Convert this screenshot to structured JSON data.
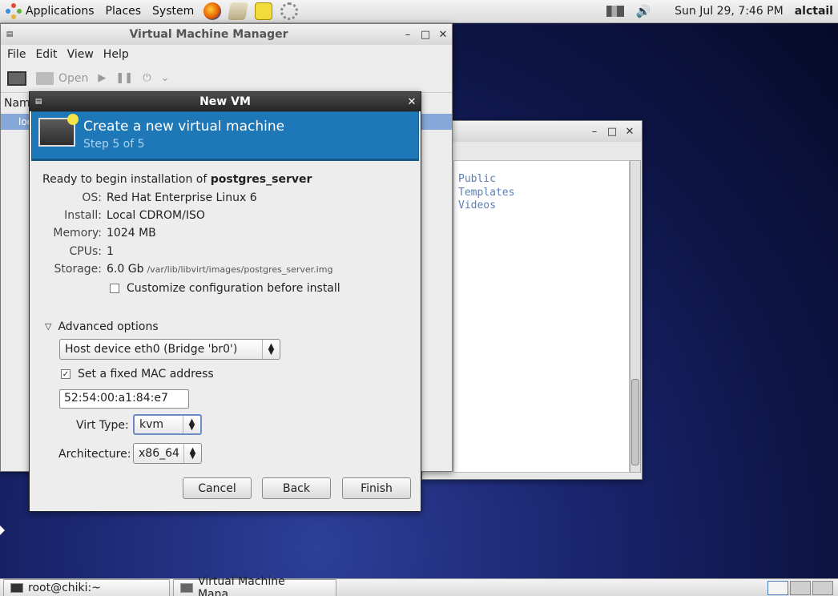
{
  "top_panel": {
    "menus": [
      "Applications",
      "Places",
      "System"
    ],
    "launchers": [
      "firefox-icon",
      "mail-icon",
      "notes-icon",
      "settings-icon"
    ],
    "clock": "Sun Jul 29,  7:46 PM",
    "user": "alctail"
  },
  "vmm_window": {
    "title": "Virtual Machine Manager",
    "menus": [
      "File",
      "Edit",
      "View",
      "Help"
    ],
    "toolbar_open": "Open",
    "column_name": "Nam",
    "row_partial": "loc"
  },
  "files_window": {
    "items": [
      "Public",
      "Templates",
      "Videos"
    ]
  },
  "dialog": {
    "title": "New VM",
    "banner_title": "Create a new virtual machine",
    "banner_step": "Step 5 of 5",
    "ready_prefix": "Ready to begin installation of ",
    "vm_name": "postgres_server",
    "details": [
      {
        "label": "OS:",
        "value": "Red Hat Enterprise Linux 6"
      },
      {
        "label": "Install:",
        "value": "Local CDROM/ISO"
      },
      {
        "label": "Memory:",
        "value": "1024 MB"
      },
      {
        "label": "CPUs:",
        "value": "1"
      }
    ],
    "storage_label": "Storage:",
    "storage_size": "6.0 Gb",
    "storage_path": "/var/lib/libvirt/images/postgres_server.img",
    "customize_label": "Customize configuration before install",
    "advanced_label": "Advanced options",
    "network_value": "Host device eth0 (Bridge 'br0')",
    "mac_checkbox_label": "Set a fixed MAC address",
    "mac_value": "52:54:00:a1:84:e7",
    "virt_type_label": "Virt Type:",
    "virt_type_value": "kvm",
    "arch_label": "Architecture:",
    "arch_value": "x86_64",
    "cancel": "Cancel",
    "back": "Back",
    "finish": "Finish"
  },
  "taskbar": {
    "tasks": [
      "root@chiki:~",
      "Virtual Machine Mana..."
    ]
  }
}
